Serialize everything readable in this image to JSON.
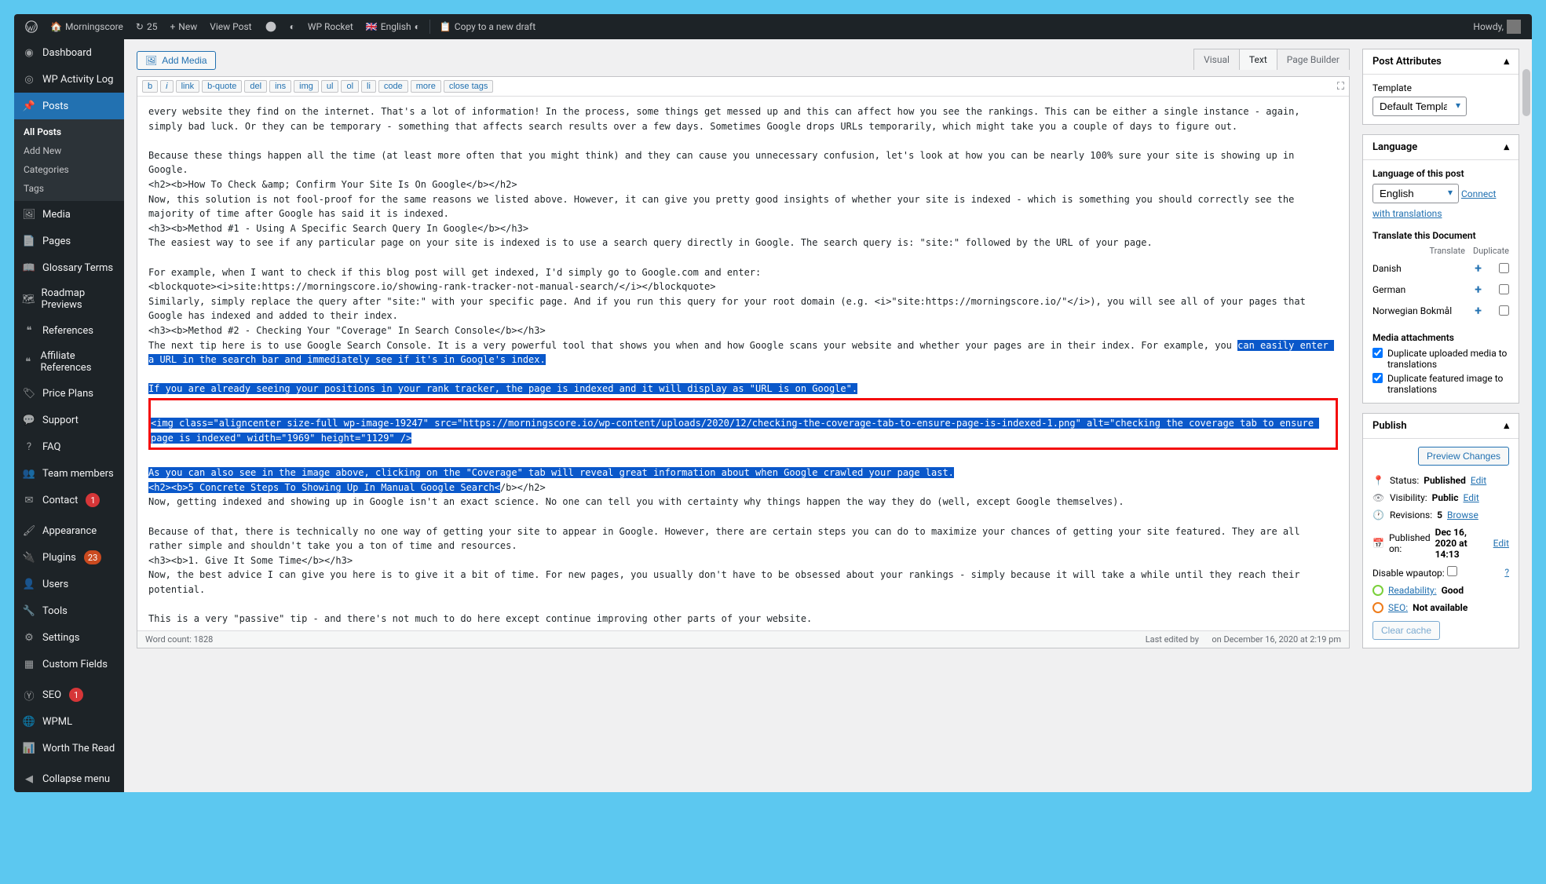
{
  "topbar": {
    "site": "Morningscore",
    "updates_count": "25",
    "new_label": "New",
    "view_post": "View Post",
    "wp_rocket": "WP Rocket",
    "language": "English",
    "copy_draft": "Copy to a new draft",
    "howdy": "Howdy,"
  },
  "sidebar": {
    "dashboard": "Dashboard",
    "activity_log": "WP Activity Log",
    "posts": "Posts",
    "all_posts": "All Posts",
    "add_new": "Add New",
    "categories": "Categories",
    "tags": "Tags",
    "media": "Media",
    "pages": "Pages",
    "glossary": "Glossary Terms",
    "roadmap": "Roadmap Previews",
    "references": "References",
    "affiliate_refs": "Affiliate References",
    "price_plans": "Price Plans",
    "support": "Support",
    "faq": "FAQ",
    "team": "Team members",
    "contact": "Contact",
    "contact_count": "1",
    "appearance": "Appearance",
    "plugins": "Plugins",
    "plugins_count": "23",
    "users": "Users",
    "tools": "Tools",
    "settings": "Settings",
    "custom_fields": "Custom Fields",
    "seo": "SEO",
    "seo_count": "1",
    "wpml": "WPML",
    "worth": "Worth The Read",
    "collapse": "Collapse menu"
  },
  "editor": {
    "add_media": "Add Media",
    "tab_visual": "Visual",
    "tab_text": "Text",
    "tab_pb": "Page Builder",
    "ql": [
      "b",
      "i",
      "link",
      "b-quote",
      "del",
      "ins",
      "img",
      "ul",
      "ol",
      "li",
      "code",
      "more",
      "close tags"
    ],
    "content_pre": "every website they find on the internet. That's a lot of information! In the process, some things get messed up and this can affect how you see the rankings. This can be either a single instance - again, simply bad luck. Or they can be temporary - something that affects search results over a few days. Sometimes Google drops URLs temporarily, which might take you a couple of days to figure out.\n\nBecause these things happen all the time (at least more often that you might think) and they can cause you unnecessary confusion, let's look at how you can be nearly 100% sure your site is showing up in Google.\n<h2><b>How To Check &amp; Confirm Your Site Is On Google</b></h2>\nNow, this solution is not fool-proof for the same reasons we listed above. However, it can give you pretty good insights of whether your site is indexed - which is something you should correctly see the majority of time after Google has said it is indexed.\n<h3><b>Method #1 - Using A Specific Search Query In Google</b></h3>\nThe easiest way to see if any particular page on your site is indexed is to use a search query directly in Google. The search query is: \"site:\" followed by the URL of your page.\n\nFor example, when I want to check if this blog post will get indexed, I'd simply go to Google.com and enter:\n<blockquote><i>site:https://morningscore.io/showing-rank-tracker-not-manual-search/</i></blockquote>\nSimilarly, simply replace the query after \"site:\" with your specific page. And if you run this query for your root domain (e.g. <i>\"site:https://morningscore.io/\"</i>), you will see all of your pages that Google has indexed and added to their index.\n<h3><b>Method #2 - Checking Your \"Coverage\" In Search Console</b></h3>\nThe next tip here is to use Google Search Console. It is a very powerful tool that shows you when and how Google scans your website and whether your pages are in their index. For example, you ",
    "sel1": "can easily enter a URL in the search bar and immediately see if it's in Google's index.",
    "sel2": "If you are already seeing your positions in your rank tracker, the page is indexed and it will display as \"URL is on Google\".",
    "sel_img": "<img class=\"aligncenter size-full wp-image-19247\" src=\"https://morningscore.io/wp-content/uploads/2020/12/checking-the-coverage-tab-to-ensure-page-is-indexed-1.png\" alt=\"checking the coverage tab to ensure page is indexed\" width=\"1969\" height=\"1129\" />",
    "sel3": "As you can also see in the image above, clicking on the \"Coverage\" tab will reveal great information about when Google crawled your page last.",
    "sel4_a": "<h2><b>5 Concrete Steps To Showing Up In Manual Google Search<",
    "content_post": "/b></h2>\nNow, getting indexed and showing up in Google isn't an exact science. No one can tell you with certainty why things happen the way they do (well, except Google themselves).\n\nBecause of that, there is technically no one way of getting your site to appear in Google. However, there are certain steps you can do to maximize your chances of getting your site featured. They are all rather simple and shouldn't take you a ton of time and resources.\n<h3><b>1. Give It Some Time</b></h3>\nNow, the best advice I can give you here is to give it a bit of time. For new pages, you usually don't have to be obsessed about your rankings - simply because it will take a while until they reach their potential.\n\nThis is a very \"passive\" tip - and there's not much to do here except continue improving other parts of your website.\n\nBut then again, I know that might not be good enough for you. So here's a few more proactive things you can do to ensure your site shows up.\n<h3><b>2. Create Internal Links</b></h3>\nThe easier it is to find your target page from your home page, the easier it is for Google to find and index it. On top of that, the stronger that page is because of the authority it gets from your homepage. And last but not least, the anchor text which is the text used in your link also helps Google.\n\nBecause of that, you can potentially speed up the indexing and ranking process by adding internal links on important words for that article somewhere close to the homepage.\n\n<b>Example:</b>\n\nSay you're a baker. You have a homepage, on which you list the different categories of products you produce - e.g. wedding cakes, birthday cakes, cookies, custom order cakes, etc.\n\nYou recently wrote a post about \"wedding cake inspiration\". Now, while that post is perfectly fine being featured in your blog, you can also add an internal link on your /wedding-cakes/ page.",
    "word_count_label": "Word count: ",
    "word_count": "1828",
    "last_edited_pre": "Last edited by",
    "last_edited_post": "on December 16, 2020 at 2:19 pm"
  },
  "panels": {
    "post_attrs": "Post Attributes",
    "template_label": "Template",
    "template_value": "Default Template",
    "language_panel": "Language",
    "lang_of_post": "Language of this post",
    "lang_value": "English",
    "connect": "Connect with translations",
    "translate_doc": "Translate this Document",
    "th_translate": "Translate",
    "th_duplicate": "Duplicate",
    "langs": [
      "Danish",
      "German",
      "Norwegian Bokmål"
    ],
    "media_attach": "Media attachments",
    "dup_media": "Duplicate uploaded media to translations",
    "dup_featured": "Duplicate featured image to translations",
    "publish": "Publish",
    "preview": "Preview Changes",
    "status_l": "Status:",
    "status_v": "Published",
    "vis_l": "Visibility:",
    "vis_v": "Public",
    "rev_l": "Revisions:",
    "rev_v": "5",
    "browse": "Browse",
    "pub_l": "Published on:",
    "pub_v": "Dec 16, 2020 at 14:13",
    "edit": "Edit",
    "disable_autop": "Disable wpautop:",
    "readability_l": "Readability:",
    "readability_v": "Good",
    "seo_l": "SEO:",
    "seo_v": "Not available",
    "clear_cache": "Clear cache"
  }
}
